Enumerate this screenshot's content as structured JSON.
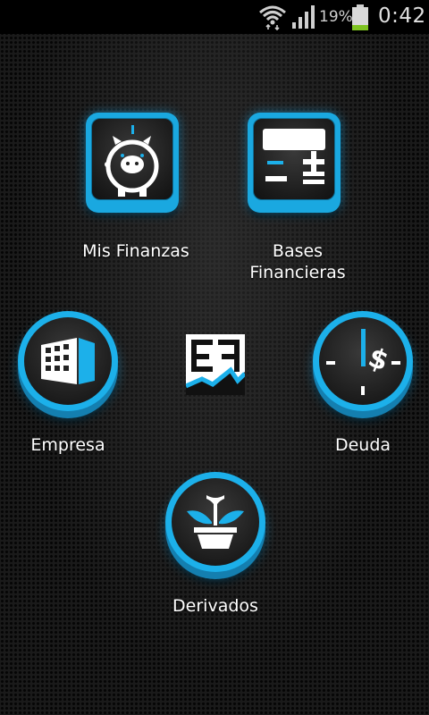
{
  "status_bar": {
    "battery_percent": "19%",
    "time": "0:42",
    "battery_level": 0.19,
    "icons": [
      "wifi-icon",
      "signal-icon",
      "battery-icon"
    ]
  },
  "menu": {
    "mis_finanzas": {
      "label": "Mis Finanzas",
      "icon": "piggy-bank-icon"
    },
    "bases_financieras": {
      "label": "Bases\nFinancieras",
      "icon": "calculator-icon"
    },
    "empresa": {
      "label": "Empresa",
      "icon": "building-icon"
    },
    "deuda": {
      "label": "Deuda",
      "icon": "clock-dollar-icon"
    },
    "derivados": {
      "label": "Derivados",
      "icon": "plant-pot-icon"
    },
    "logo": {
      "icon": "app-logo"
    }
  },
  "colors": {
    "accent": "#1cb0ea",
    "background": "#1a1a1a",
    "battery": "#7ec321"
  }
}
